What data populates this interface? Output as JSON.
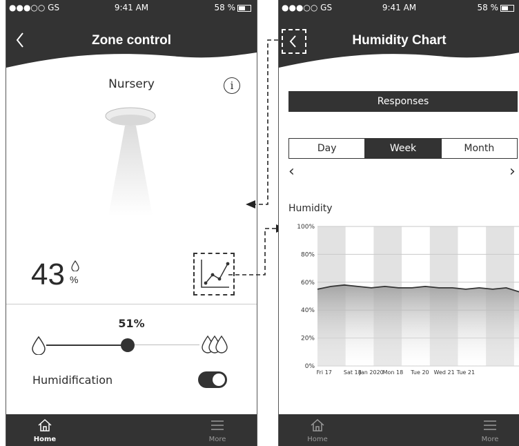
{
  "status": {
    "carrier": "●●●○○ GS",
    "time": "9:41 AM",
    "battery": "58 %"
  },
  "zone": {
    "title": "Zone control",
    "room": "Nursery",
    "info_label": "i",
    "humidity_value": "43",
    "humidity_unit": "%",
    "setpoint": "51%",
    "setpoint_fraction": 0.51,
    "humidification_label": "Humidification",
    "humidification_on": true
  },
  "chartscreen": {
    "title": "Humidity Chart",
    "responses_label": "Responses",
    "segments": [
      "Day",
      "Week",
      "Month"
    ],
    "active_segment": "Week",
    "prev": "‹",
    "next": "›",
    "humidity_label": "Humidity"
  },
  "tabs": {
    "home": "Home",
    "more": "More"
  },
  "colors": {
    "dark": "#333333",
    "band": "#e2e2e2"
  },
  "chart_data": {
    "type": "line",
    "ylabel": "Humidity",
    "ylim": [
      0,
      100
    ],
    "yticks": [
      "0%",
      "20%",
      "40%",
      "60%",
      "80%",
      "100%"
    ],
    "xticks": [
      "Fri 17",
      "Sat 18",
      "Jan 2020",
      "Mon 18",
      "Tue 20",
      "Wed 21",
      "Tue 21"
    ],
    "x": [
      0,
      0.5,
      1,
      1.5,
      2,
      2.5,
      3,
      3.5,
      4,
      4.5,
      5,
      5.5,
      6,
      6.5,
      7,
      7.5
    ],
    "values": [
      55,
      57,
      58,
      57,
      56,
      57,
      56,
      56,
      57,
      56,
      56,
      55,
      56,
      55,
      56,
      53
    ],
    "fill": "area"
  }
}
